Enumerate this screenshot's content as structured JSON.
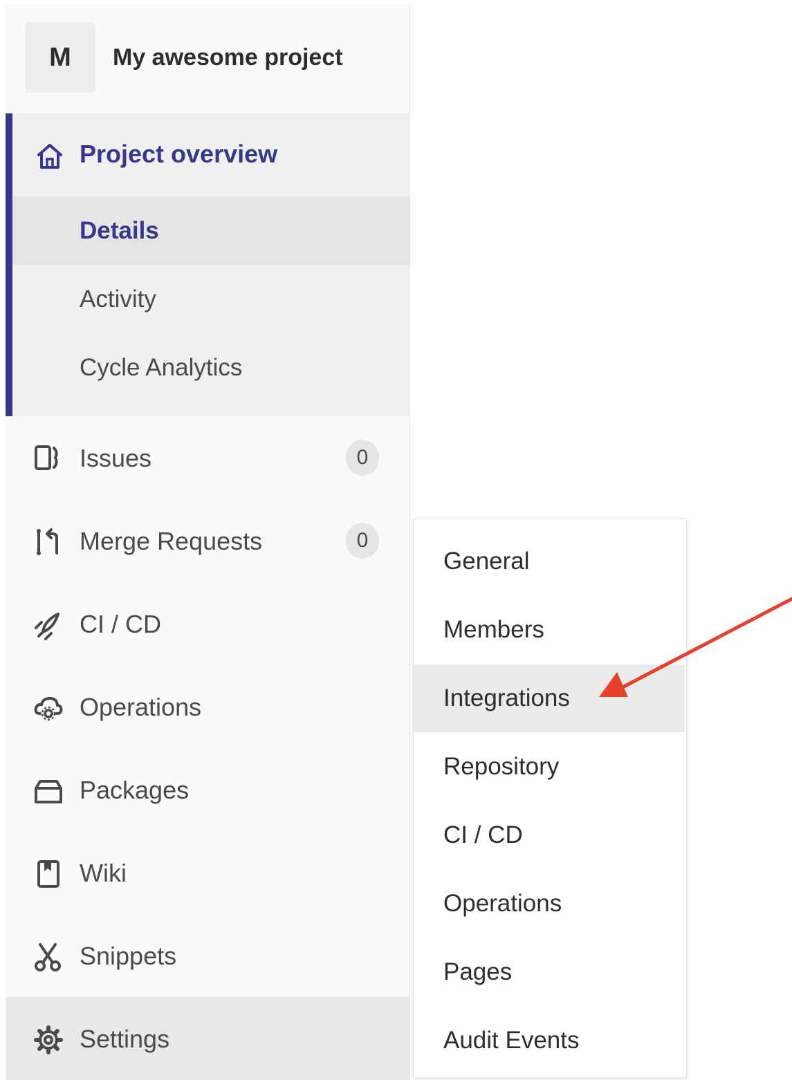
{
  "project": {
    "avatar_letter": "M",
    "name": "My awesome project"
  },
  "overview": {
    "label": "Project overview",
    "icon": "home-icon",
    "items": [
      {
        "label": "Details",
        "active": true
      },
      {
        "label": "Activity",
        "active": false
      },
      {
        "label": "Cycle Analytics",
        "active": false
      }
    ]
  },
  "nav": {
    "issues": {
      "label": "Issues",
      "count": "0",
      "icon": "issues-icon"
    },
    "merge_requests": {
      "label": "Merge Requests",
      "count": "0",
      "icon": "merge-request-icon"
    },
    "ci_cd": {
      "label": "CI / CD",
      "icon": "rocket-icon"
    },
    "operations": {
      "label": "Operations",
      "icon": "cloud-gear-icon"
    },
    "packages": {
      "label": "Packages",
      "icon": "package-icon"
    },
    "wiki": {
      "label": "Wiki",
      "icon": "book-icon"
    },
    "snippets": {
      "label": "Snippets",
      "icon": "scissors-icon"
    },
    "settings": {
      "label": "Settings",
      "icon": "gear-icon"
    }
  },
  "settings_flyout": {
    "items": [
      {
        "label": "General"
      },
      {
        "label": "Members"
      },
      {
        "label": "Integrations",
        "highlighted": true
      },
      {
        "label": "Repository"
      },
      {
        "label": "CI / CD"
      },
      {
        "label": "Operations"
      },
      {
        "label": "Pages"
      },
      {
        "label": "Audit Events"
      }
    ]
  },
  "annotation": {
    "arrow_color": "#e8402a",
    "points_to": "Integrations"
  },
  "colors": {
    "accent": "#37378d",
    "sidebar_bg": "#fafafa",
    "active_bg": "#f0f0f0"
  }
}
